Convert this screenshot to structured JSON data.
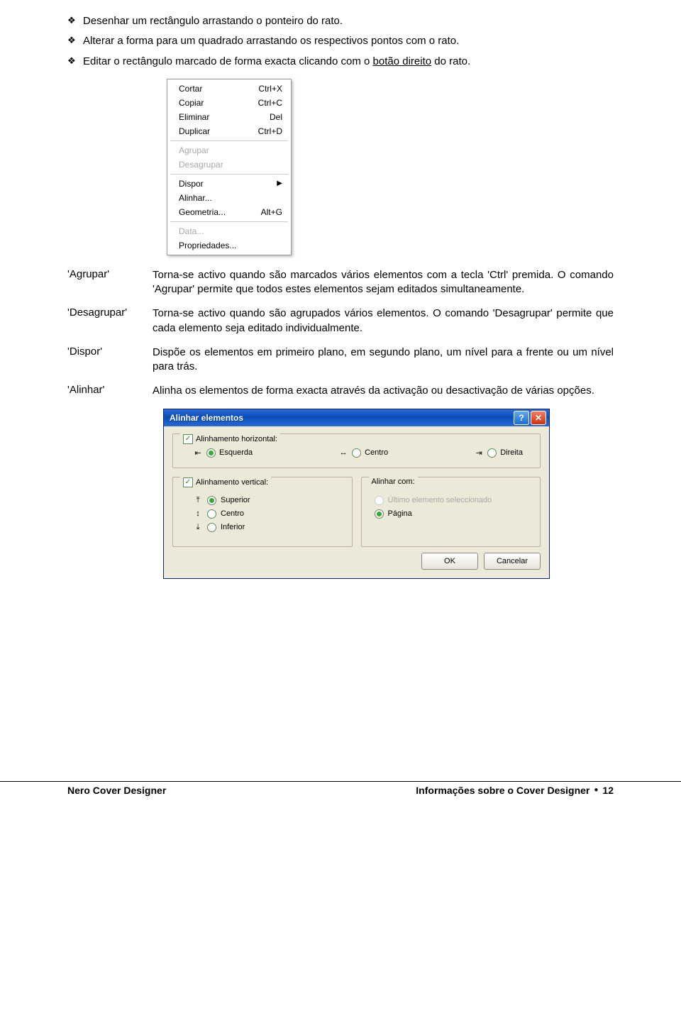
{
  "bullets": [
    "Desenhar um rectângulo arrastando o ponteiro do rato.",
    "Alterar a forma para um quadrado arrastando os respectivos pontos com o rato.",
    "Editar o rectângulo marcado de forma exacta clicando com o "
  ],
  "bullet3_underlined": "botão direito",
  "bullet3_suffix": " do rato.",
  "context_menu": {
    "items": [
      {
        "label": "Cortar",
        "shortcut": "Ctrl+X"
      },
      {
        "label": "Copiar",
        "shortcut": "Ctrl+C"
      },
      {
        "label": "Eliminar",
        "shortcut": "Del"
      },
      {
        "label": "Duplicar",
        "shortcut": "Ctrl+D"
      }
    ],
    "disabled_group": [
      "Agrupar",
      "Desagrupar"
    ],
    "group2": [
      {
        "label": "Dispor",
        "submenu": true
      },
      {
        "label": "Alinhar...",
        "submenu": false
      },
      {
        "label": "Geometria...",
        "shortcut": "Alt+G"
      }
    ],
    "disabled_single": "Data...",
    "last": "Propriedades..."
  },
  "definitions": [
    {
      "term": "'Agrupar'",
      "desc": "Torna-se activo quando são marcados vários elementos com a tecla 'Ctrl' premida. O comando 'Agrupar' permite que todos estes elementos sejam editados simultaneamente."
    },
    {
      "term": "'Desagrupar'",
      "desc": "Torna-se activo quando são agrupados vários elementos. O comando 'Desagrupar' permite que cada elemento seja editado individualmente."
    },
    {
      "term": "'Dispor'",
      "desc": "Dispõe os elementos em primeiro plano, em segundo plano, um nível para a frente ou um nível para trás."
    },
    {
      "term": "'Alinhar'",
      "desc": "Alinha os elementos de forma exacta através da activação ou desactivação de várias opções."
    }
  ],
  "dialog": {
    "title": "Alinhar elementos",
    "horizontal": {
      "legend": "Alinhamento horizontal:",
      "options": [
        "Esquerda",
        "Centro",
        "Direita"
      ],
      "selected": 0
    },
    "vertical": {
      "legend": "Alinhamento vertical:",
      "options": [
        "Superior",
        "Centro",
        "Inferior"
      ],
      "selected": 0
    },
    "align_with": {
      "legend": "Alinhar com:",
      "options": [
        "Último elemento seleccionado",
        "Página"
      ],
      "selected": 1,
      "disabled": 0
    },
    "buttons": {
      "ok": "OK",
      "cancel": "Cancelar"
    }
  },
  "footer": {
    "left": "Nero Cover Designer",
    "right_text": "Informações sobre o Cover Designer",
    "page_no": "12"
  }
}
